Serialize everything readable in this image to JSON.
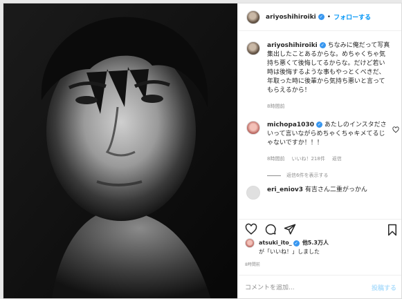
{
  "header": {
    "username": "ariyoshihiroiki",
    "separator": "•",
    "follow_label": "フォローする"
  },
  "caption": {
    "username": "ariyoshihiroiki",
    "text": "ちなみに俺だって写真集出したことあるからな。めちゃくちゃ気持ち悪くて後悔してるからな。だけど若い時は後悔するような事もやっとくべきだ、年取った時に後輩から気持ち悪いと言ってもらえるから！",
    "time": "8時間前"
  },
  "comment": {
    "username": "michopa1030",
    "text": "あたしのインスタださいって言いながらめちゃくちゃキメてるじゃないですか！！！",
    "time": "8時間前",
    "likes": "いいね！218件",
    "reply": "返信",
    "view_replies": "返信6件を表示する"
  },
  "comment2": {
    "username": "eri_eniov3",
    "text": "有吉さん二重がっかん"
  },
  "likes": {
    "username": "atsuki_ito_",
    "count_text": "他5.3万人",
    "suffix": "が「いいね！」しました"
  },
  "post_time": "8時間前",
  "add_comment": {
    "placeholder": "コメントを追加...",
    "post_label": "投稿する"
  },
  "icons": [
    "verified-badge-icon",
    "heart-icon",
    "comment-icon",
    "share-icon",
    "bookmark-icon"
  ],
  "colors": {
    "link": "#0095f6",
    "verified": "#3897f0",
    "muted": "#8e8e8e"
  }
}
